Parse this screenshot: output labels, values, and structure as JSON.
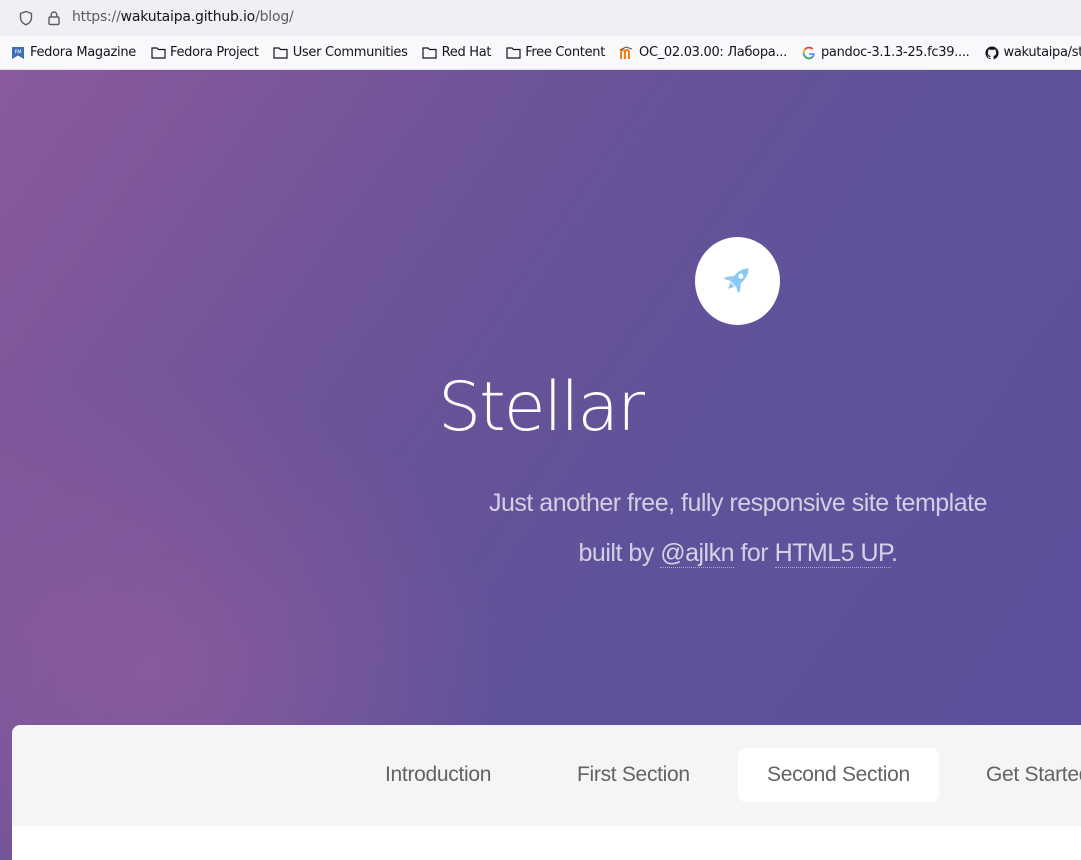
{
  "browser": {
    "url_scheme": "https://",
    "url_host": "wakutaipa.github.io",
    "url_path": "/blog/",
    "icons": [
      "shield-icon",
      "lock-icon"
    ]
  },
  "bookmarks": [
    {
      "label": "Fedora Magazine",
      "icon": "fedora-magazine-icon"
    },
    {
      "label": "Fedora Project",
      "icon": "folder-icon"
    },
    {
      "label": "User Communities",
      "icon": "folder-icon"
    },
    {
      "label": "Red Hat",
      "icon": "folder-icon"
    },
    {
      "label": "Free Content",
      "icon": "folder-icon"
    },
    {
      "label": "ОС_02.03.00: Лабора...",
      "icon": "moodle-icon"
    },
    {
      "label": "pandoc-3.1.3-25.fc39....",
      "icon": "google-icon"
    },
    {
      "label": "wakutaipa/stud",
      "icon": "github-icon"
    }
  ],
  "hero": {
    "logo_icon": "rocket-icon",
    "title": "Stellar",
    "tagline_line1": "Just another free, fully responsive site template",
    "tagline_built_by": "built by",
    "tagline_author": "@ajlkn",
    "tagline_for": "for",
    "tagline_site": "HTML5 UP",
    "tagline_end": "."
  },
  "nav": {
    "items": [
      {
        "label": "Introduction",
        "active": false
      },
      {
        "label": "First Section",
        "active": false
      },
      {
        "label": "Second Section",
        "active": true
      },
      {
        "label": "Get Started",
        "active": false
      }
    ]
  },
  "colors": {
    "hero_gradient_start": "#8a5a9c",
    "hero_gradient_end": "#5a509c",
    "rocket": "#8cc9f0"
  }
}
